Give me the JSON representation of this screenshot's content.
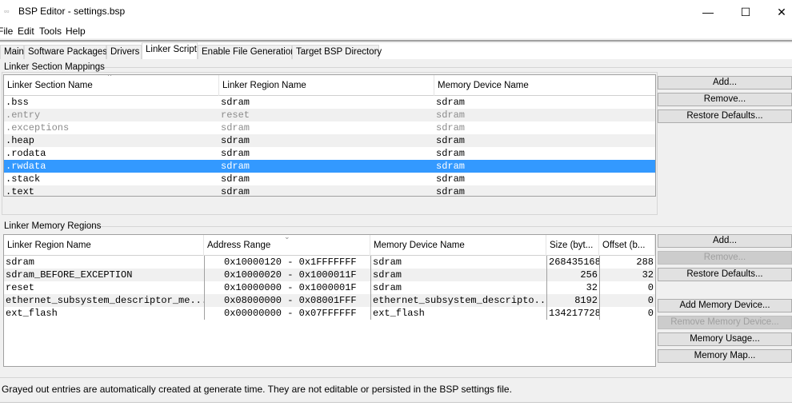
{
  "window": {
    "title": "BSP Editor - settings.bsp",
    "minimize": "—",
    "maximize": "☐",
    "close": "✕"
  },
  "menu": [
    "File",
    "Edit",
    "Tools",
    "Help"
  ],
  "tabs": [
    "Main",
    "Software Packages",
    "Drivers",
    "Linker Script",
    "Enable File Generation",
    "Target BSP Directory"
  ],
  "active_tab": "Linker Script",
  "section_mappings": {
    "title": "Linker Section Mappings",
    "columns": [
      "Linker Section Name",
      "Linker Region Name",
      "Memory Device Name"
    ],
    "rows": [
      [
        ".bss",
        "sdram",
        "sdram"
      ],
      [
        ".entry",
        "reset",
        "sdram"
      ],
      [
        ".exceptions",
        "sdram",
        "sdram"
      ],
      [
        ".heap",
        "sdram",
        "sdram"
      ],
      [
        ".rodata",
        "sdram",
        "sdram"
      ],
      [
        ".rwdata",
        "sdram",
        "sdram"
      ],
      [
        ".stack",
        "sdram",
        "sdram"
      ],
      [
        ".text",
        "sdram",
        "sdram"
      ]
    ],
    "selected_row": ".rwdata",
    "grayed_rows": [
      ".entry",
      ".exceptions"
    ],
    "buttons": {
      "add": "Add...",
      "remove": "Remove...",
      "restore": "Restore Defaults..."
    }
  },
  "memory_regions": {
    "title": "Linker Memory Regions",
    "columns": [
      "Linker Region Name",
      "Address Range",
      "Memory Device Name",
      "Size (byt...",
      "Offset (b..."
    ],
    "rows": [
      [
        "sdram",
        "0x10000120 - 0x1FFFFFFF",
        "sdram",
        "268435168",
        "288"
      ],
      [
        "sdram_BEFORE_EXCEPTION",
        "0x10000020 - 0x1000011F",
        "sdram",
        "256",
        "32"
      ],
      [
        "reset",
        "0x10000000 - 0x1000001F",
        "sdram",
        "32",
        "0"
      ],
      [
        "ethernet_subsystem_descriptor_me...",
        "0x08000000 - 0x08001FFF",
        "ethernet_subsystem_descripto...",
        "8192",
        "0"
      ],
      [
        "ext_flash",
        "0x00000000 - 0x07FFFFFF",
        "ext_flash",
        "134217728",
        "0"
      ]
    ],
    "buttons": {
      "add": "Add...",
      "remove": "Remove...",
      "restore": "Restore Defaults...",
      "add_device": "Add Memory Device...",
      "remove_device": "Remove Memory Device...",
      "usage": "Memory Usage...",
      "map": "Memory Map..."
    }
  },
  "status": "Grayed out entries are automatically created at generate time. They are not editable or persisted in the BSP settings file.",
  "colors": {
    "selection": "#3399ff"
  }
}
